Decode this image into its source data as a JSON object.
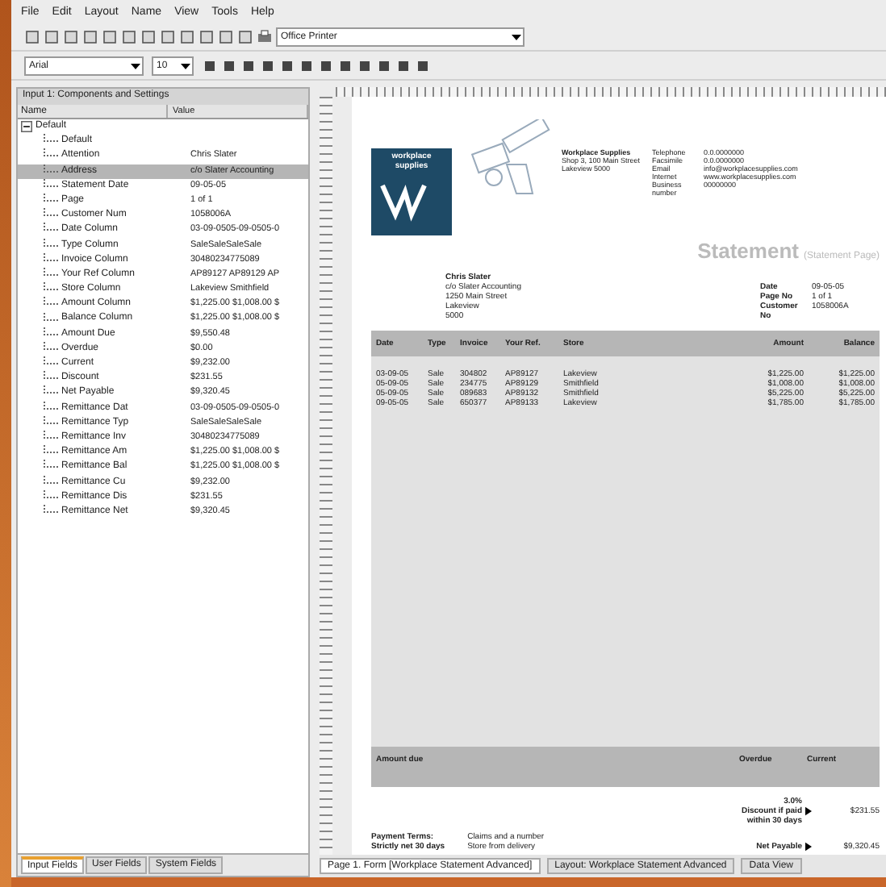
{
  "menu": [
    "File",
    "Edit",
    "Layout",
    "Name",
    "View",
    "Tools",
    "Help"
  ],
  "toolbar": {
    "printer": "Office Printer",
    "font": "Arial",
    "size": "10"
  },
  "panel": {
    "title": "Input 1: Components and Settings",
    "columns": [
      "Name",
      "Value"
    ],
    "items": [
      {
        "name": "Default",
        "expanded": true,
        "selected": false,
        "children": [
          {
            "name": "Default",
            "selected": false
          },
          {
            "name": "Attention",
            "value": "Chris Slater",
            "selected": false
          },
          {
            "name": "Address",
            "value": "c/o Slater Accounting",
            "selected": true
          },
          {
            "name": "Statement Date",
            "value": "09-05-05",
            "selected": false
          },
          {
            "name": "Page",
            "value": "1 of 1",
            "selected": false
          },
          {
            "name": "Customer Num",
            "value": "1058006A",
            "selected": false
          },
          {
            "name": "Date Column",
            "value": "03-09-0505-09-0505-0",
            "selected": false
          },
          {
            "name": "Type Column",
            "value": "SaleSaleSaleSale",
            "selected": false
          },
          {
            "name": "Invoice Column",
            "value": "30480234775089",
            "selected": false
          },
          {
            "name": "Your Ref Column",
            "value": "AP89127 AP89129 AP",
            "selected": false
          },
          {
            "name": "Store Column",
            "value": "Lakeview   Smithfield",
            "selected": false
          },
          {
            "name": "Amount Column",
            "value": "$1,225.00 $1,008.00 $",
            "selected": false
          },
          {
            "name": "Balance Column",
            "value": "$1,225.00 $1,008.00 $",
            "selected": false
          },
          {
            "name": "Amount Due",
            "value": "$9,550.48",
            "selected": false
          },
          {
            "name": "Overdue",
            "value": "$0.00",
            "selected": false
          },
          {
            "name": "Current",
            "value": "$9,232.00",
            "selected": false
          },
          {
            "name": "Discount",
            "value": "$231.55",
            "selected": false
          },
          {
            "name": "Net Payable",
            "value": "$9,320.45",
            "selected": false
          },
          {
            "name": "Remittance Dat",
            "value": "03-09-0505-09-0505-0",
            "selected": false
          },
          {
            "name": "Remittance Typ",
            "value": "SaleSaleSaleSale",
            "selected": false
          },
          {
            "name": "Remittance Inv",
            "value": "30480234775089",
            "selected": false
          },
          {
            "name": "Remittance Am",
            "value": "$1,225.00 $1,008.00 $",
            "selected": false
          },
          {
            "name": "Remittance Bal",
            "value": "$1,225.00 $1,008.00 $",
            "selected": false
          },
          {
            "name": "Remittance Cu",
            "value": "$9,232.00",
            "selected": false
          },
          {
            "name": "Remittance Dis",
            "value": "$231.55",
            "selected": false
          },
          {
            "name": "Remittance Net",
            "value": "$9,320.45",
            "selected": false
          }
        ]
      }
    ],
    "tabs": [
      {
        "label": "Input Fields",
        "selected": true
      },
      {
        "label": "User Fields",
        "selected": false
      },
      {
        "label": "System Fields",
        "selected": false
      }
    ]
  },
  "report": {
    "logo": [
      "workplace",
      "supplies"
    ],
    "company": [
      "Workplace Supplies",
      "Shop 3, 100 Main Street",
      "Lakeview  5000"
    ],
    "contact": [
      [
        "Telephone",
        "0.0.0000000"
      ],
      [
        "Facsimile",
        "0.0.0000000"
      ],
      [
        "Email",
        "info@workplacesupplies.com"
      ],
      [
        "Internet",
        "www.workplacesupplies.com"
      ],
      [
        "Business number",
        "00000000"
      ]
    ],
    "title": "Statement",
    "subtitle": "(Statement Page)",
    "customer": [
      "Chris Slater",
      "c/o Slater Accounting",
      "1250 Main Street",
      "Lakeview",
      "5000"
    ],
    "meta": [
      [
        "Date",
        "09-05-05"
      ],
      [
        "Page No",
        "1 of 1"
      ],
      [
        "Customer No",
        "1058006A"
      ]
    ],
    "columns": [
      "Date",
      "Type",
      "Invoice",
      "Your Ref.",
      "Store",
      "Amount",
      "Balance"
    ],
    "rows": [
      [
        "03-09-05",
        "Sale",
        "304802",
        "AP89127",
        "Lakeview",
        "$1,225.00",
        "$1,225.00"
      ],
      [
        "05-09-05",
        "Sale",
        "234775",
        "AP89129",
        "Smithfield",
        "$1,008.00",
        "$1,008.00"
      ],
      [
        "05-09-05",
        "Sale",
        "089683",
        "AP89132",
        "Smithfield",
        "$5,225.00",
        "$5,225.00"
      ],
      [
        "09-05-05",
        "Sale",
        "650377",
        "AP89133",
        "Lakeview",
        "$1,785.00",
        "$1,785.00"
      ]
    ],
    "totals": [
      "Amount due",
      "Overdue",
      "Current"
    ],
    "discount": [
      "3.0%",
      "Discount if paid",
      "within 30 days"
    ],
    "discount_value": "$231.55",
    "net_label": "Net Payable",
    "net_value": "$9,320.45",
    "terms": [
      "Payment Terms:",
      "Strictly net 30 days"
    ],
    "notes": [
      "Claims and a number",
      "Store from delivery"
    ]
  },
  "bottom_tabs": [
    {
      "label": "Page 1. Form [Workplace Statement Advanced]",
      "selected": true
    },
    {
      "label": "Layout: Workplace Statement Advanced",
      "selected": false
    },
    {
      "label": "Data View",
      "selected": false
    }
  ]
}
